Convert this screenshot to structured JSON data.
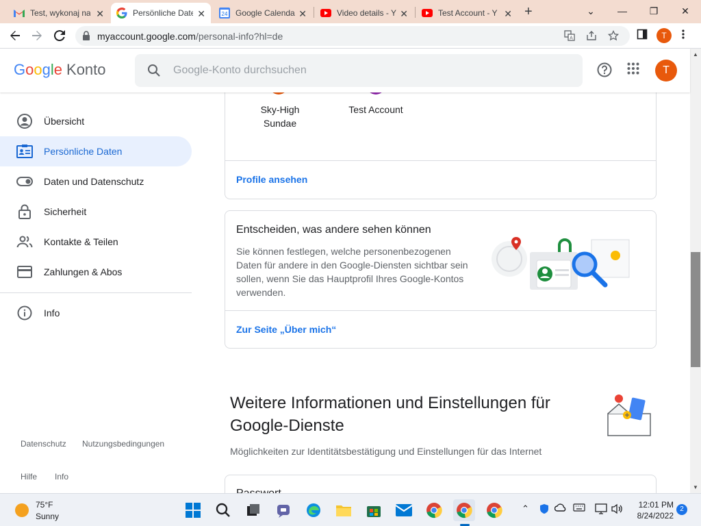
{
  "browser": {
    "tabs": [
      {
        "title": "Test, wykonaj na",
        "icon": "gmail-icon"
      },
      {
        "title": "Persönliche Date",
        "icon": "google-icon",
        "active": true
      },
      {
        "title": "Google Calenda",
        "icon": "calendar-icon",
        "badge": "24"
      },
      {
        "title": "Video details - Y",
        "icon": "youtube-icon"
      },
      {
        "title": "Test Account - Y",
        "icon": "youtube-icon"
      }
    ],
    "url_host": "myaccount.google.com",
    "url_path": "/personal-info?hl=de",
    "profile_initial": "T"
  },
  "header": {
    "logo_google": "Google",
    "logo_product": "Konto",
    "search_placeholder": "Google-Konto durchsuchen",
    "avatar_initial": "T"
  },
  "sidebar": {
    "items": [
      {
        "label": "Übersicht",
        "icon": "account-circle-icon"
      },
      {
        "label": "Persönliche Daten",
        "icon": "id-card-icon",
        "active": true
      },
      {
        "label": "Daten und Datenschutz",
        "icon": "toggle-icon"
      },
      {
        "label": "Sicherheit",
        "icon": "lock-icon"
      },
      {
        "label": "Kontakte & Teilen",
        "icon": "people-icon"
      },
      {
        "label": "Zahlungen & Abos",
        "icon": "credit-card-icon"
      }
    ],
    "info_label": "Info",
    "footer": {
      "privacy": "Datenschutz",
      "terms": "Nutzungsbedingungen",
      "help": "Hilfe",
      "info": "Info"
    }
  },
  "main": {
    "profiles_card": {
      "profiles": [
        {
          "name_line1": "Sky-High",
          "name_line2": "Sundae",
          "color": "#e8590c"
        },
        {
          "name_line1": "Test Account",
          "name_line2": "",
          "color": "#8e24aa"
        }
      ],
      "link": "Profile ansehen"
    },
    "visibility_card": {
      "title": "Entscheiden, was andere sehen können",
      "description": "Sie können festlegen, welche personenbezogenen Daten für andere in den Google-Diensten sichtbar sein sollen, wenn Sie das Hauptprofil Ihres Google-Kontos verwenden.",
      "link": "Zur Seite „Über mich“"
    },
    "section": {
      "title": "Weitere Informationen und Einstellungen für Google-Dienste",
      "subtitle": "Möglichkeiten zur Identitätsbestätigung und Einstellungen für das Internet"
    },
    "next_card_title": "Passwort"
  },
  "taskbar": {
    "temperature": "75°F",
    "condition": "Sunny",
    "time": "12:01 PM",
    "date": "8/24/2022",
    "notifications": "2"
  }
}
